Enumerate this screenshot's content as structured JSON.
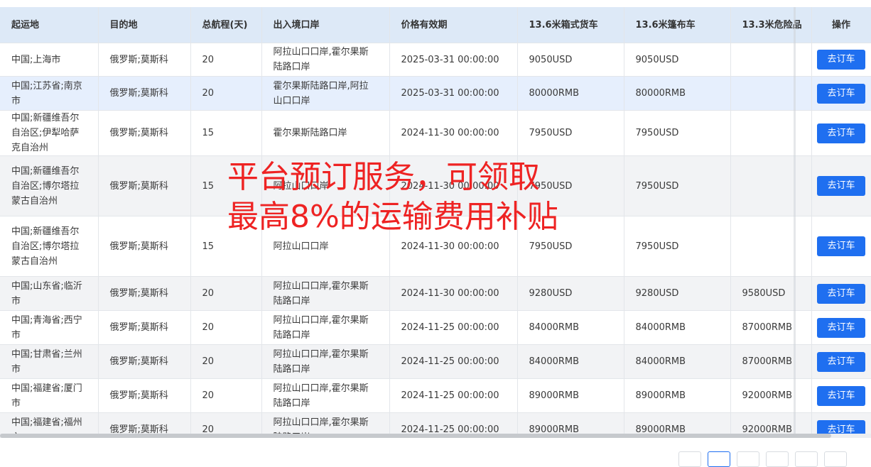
{
  "table": {
    "columns": [
      "起运地",
      "目的地",
      "总航程(天)",
      "出入境口岸",
      "价格有效期",
      "13.6米箱式货车",
      "13.6米篷布车",
      "13.3米危险品",
      "操作"
    ],
    "rows": [
      {
        "origin": "中国;上海市",
        "dest": "俄罗斯;莫斯科",
        "days": "20",
        "port": "阿拉山口口岸,霍尔果斯陆路口岸",
        "validity": "2025-03-31 00:00:00",
        "box": "9050USD",
        "tarp": "9050USD",
        "danger": "",
        "action": "去订车"
      },
      {
        "origin": "中国;江苏省;南京市",
        "dest": "俄罗斯;莫斯科",
        "days": "20",
        "port": "霍尔果斯陆路口岸,阿拉山口口岸",
        "validity": "2025-03-31 00:00:00",
        "box": "80000RMB",
        "tarp": "80000RMB",
        "danger": "",
        "action": "去订车"
      },
      {
        "origin": "中国;新疆维吾尔自治区;伊犁哈萨克自治州",
        "dest": "俄罗斯;莫斯科",
        "days": "15",
        "port": "霍尔果斯陆路口岸",
        "validity": "2024-11-30 00:00:00",
        "box": "7950USD",
        "tarp": "7950USD",
        "danger": "",
        "action": "去订车"
      },
      {
        "origin": "中国;新疆维吾尔自治区;博尔塔拉蒙古自治州",
        "dest": "俄罗斯;莫斯科",
        "days": "15",
        "port": "阿拉山口口岸",
        "validity": "2024-11-30 00:00:00",
        "box": "7950USD",
        "tarp": "7950USD",
        "danger": "",
        "action": "去订车"
      },
      {
        "origin": "中国;新疆维吾尔自治区;博尔塔拉蒙古自治州",
        "dest": "俄罗斯;莫斯科",
        "days": "15",
        "port": "阿拉山口口岸",
        "validity": "2024-11-30 00:00:00",
        "box": "7950USD",
        "tarp": "7950USD",
        "danger": "",
        "action": "去订车"
      },
      {
        "origin": "中国;山东省;临沂市",
        "dest": "俄罗斯;莫斯科",
        "days": "20",
        "port": "阿拉山口口岸,霍尔果斯陆路口岸",
        "validity": "2024-11-30 00:00:00",
        "box": "9280USD",
        "tarp": "9280USD",
        "danger": "9580USD",
        "action": "去订车"
      },
      {
        "origin": "中国;青海省;西宁市",
        "dest": "俄罗斯;莫斯科",
        "days": "20",
        "port": "阿拉山口口岸,霍尔果斯陆路口岸",
        "validity": "2024-11-25 00:00:00",
        "box": "84000RMB",
        "tarp": "84000RMB",
        "danger": "87000RMB",
        "action": "去订车"
      },
      {
        "origin": "中国;甘肃省;兰州市",
        "dest": "俄罗斯;莫斯科",
        "days": "20",
        "port": "阿拉山口口岸,霍尔果斯陆路口岸",
        "validity": "2024-11-25 00:00:00",
        "box": "84000RMB",
        "tarp": "84000RMB",
        "danger": "87000RMB",
        "action": "去订车"
      },
      {
        "origin": "中国;福建省;厦门市",
        "dest": "俄罗斯;莫斯科",
        "days": "20",
        "port": "阿拉山口口岸,霍尔果斯陆路口岸",
        "validity": "2024-11-25 00:00:00",
        "box": "89000RMB",
        "tarp": "89000RMB",
        "danger": "92000RMB",
        "action": "去订车"
      },
      {
        "origin": "中国;福建省;福州市",
        "dest": "俄罗斯;莫斯科",
        "days": "20",
        "port": "阿拉山口口岸,霍尔果斯陆路口岸",
        "validity": "2024-11-25 00:00:00",
        "box": "89000RMB",
        "tarp": "89000RMB",
        "danger": "92000RMB",
        "action": "去订车"
      }
    ]
  },
  "promo": {
    "line1": "平台预订服务，可领取",
    "line2": "最高8%的运输费用补贴"
  },
  "colors": {
    "header_bg": "#dde9f7",
    "highlight_row": "#e6effd",
    "band_row": "#f2f3f5",
    "button": "#1f6ff0",
    "promo_text": "#ee2323"
  }
}
